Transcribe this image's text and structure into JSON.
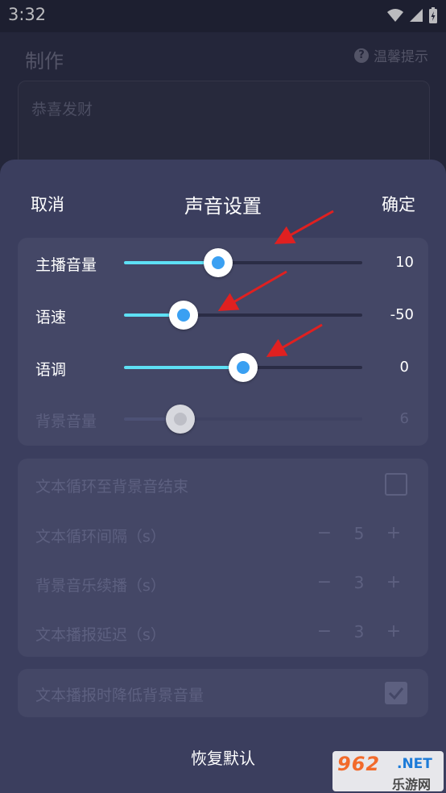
{
  "status_bar": {
    "time": "3:32"
  },
  "background": {
    "title": "制作",
    "help_label": "温馨提示",
    "input_text": "恭喜发财"
  },
  "sheet": {
    "cancel_label": "取消",
    "title": "声音设置",
    "confirm_label": "确定",
    "sliders": [
      {
        "label": "主播音量",
        "value": "10",
        "fraction": 0.395,
        "enabled": true
      },
      {
        "label": "语速",
        "value": "-50",
        "fraction": 0.25,
        "enabled": true
      },
      {
        "label": "语调",
        "value": "0",
        "fraction": 0.5,
        "enabled": true
      },
      {
        "label": "背景音量",
        "value": "6",
        "fraction": 0.237,
        "enabled": false
      }
    ],
    "options": {
      "loop_to_end_label": "文本循环至背景音结束",
      "loop_interval_label": "文本循环间隔（s）",
      "loop_interval_value": "5",
      "bgm_continue_label": "背景音乐续播（s）",
      "bgm_continue_value": "3",
      "broadcast_delay_label": "文本播报延迟（s）",
      "broadcast_delay_value": "3",
      "minus_glyph": "−",
      "plus_glyph": "+"
    },
    "duck_label": "文本播报时降低背景音量",
    "restore_label": "恢复默认"
  },
  "watermark": {
    "brand": "962",
    "domain": ".NET",
    "site_name": "乐游网"
  },
  "colors": {
    "sheet_bg": "#3b3e5e",
    "card_bg": "#444766",
    "slider_fill": "#5ee0f5",
    "thumb_dot": "#3aa0f2",
    "annotation_arrow": "#e02020"
  }
}
